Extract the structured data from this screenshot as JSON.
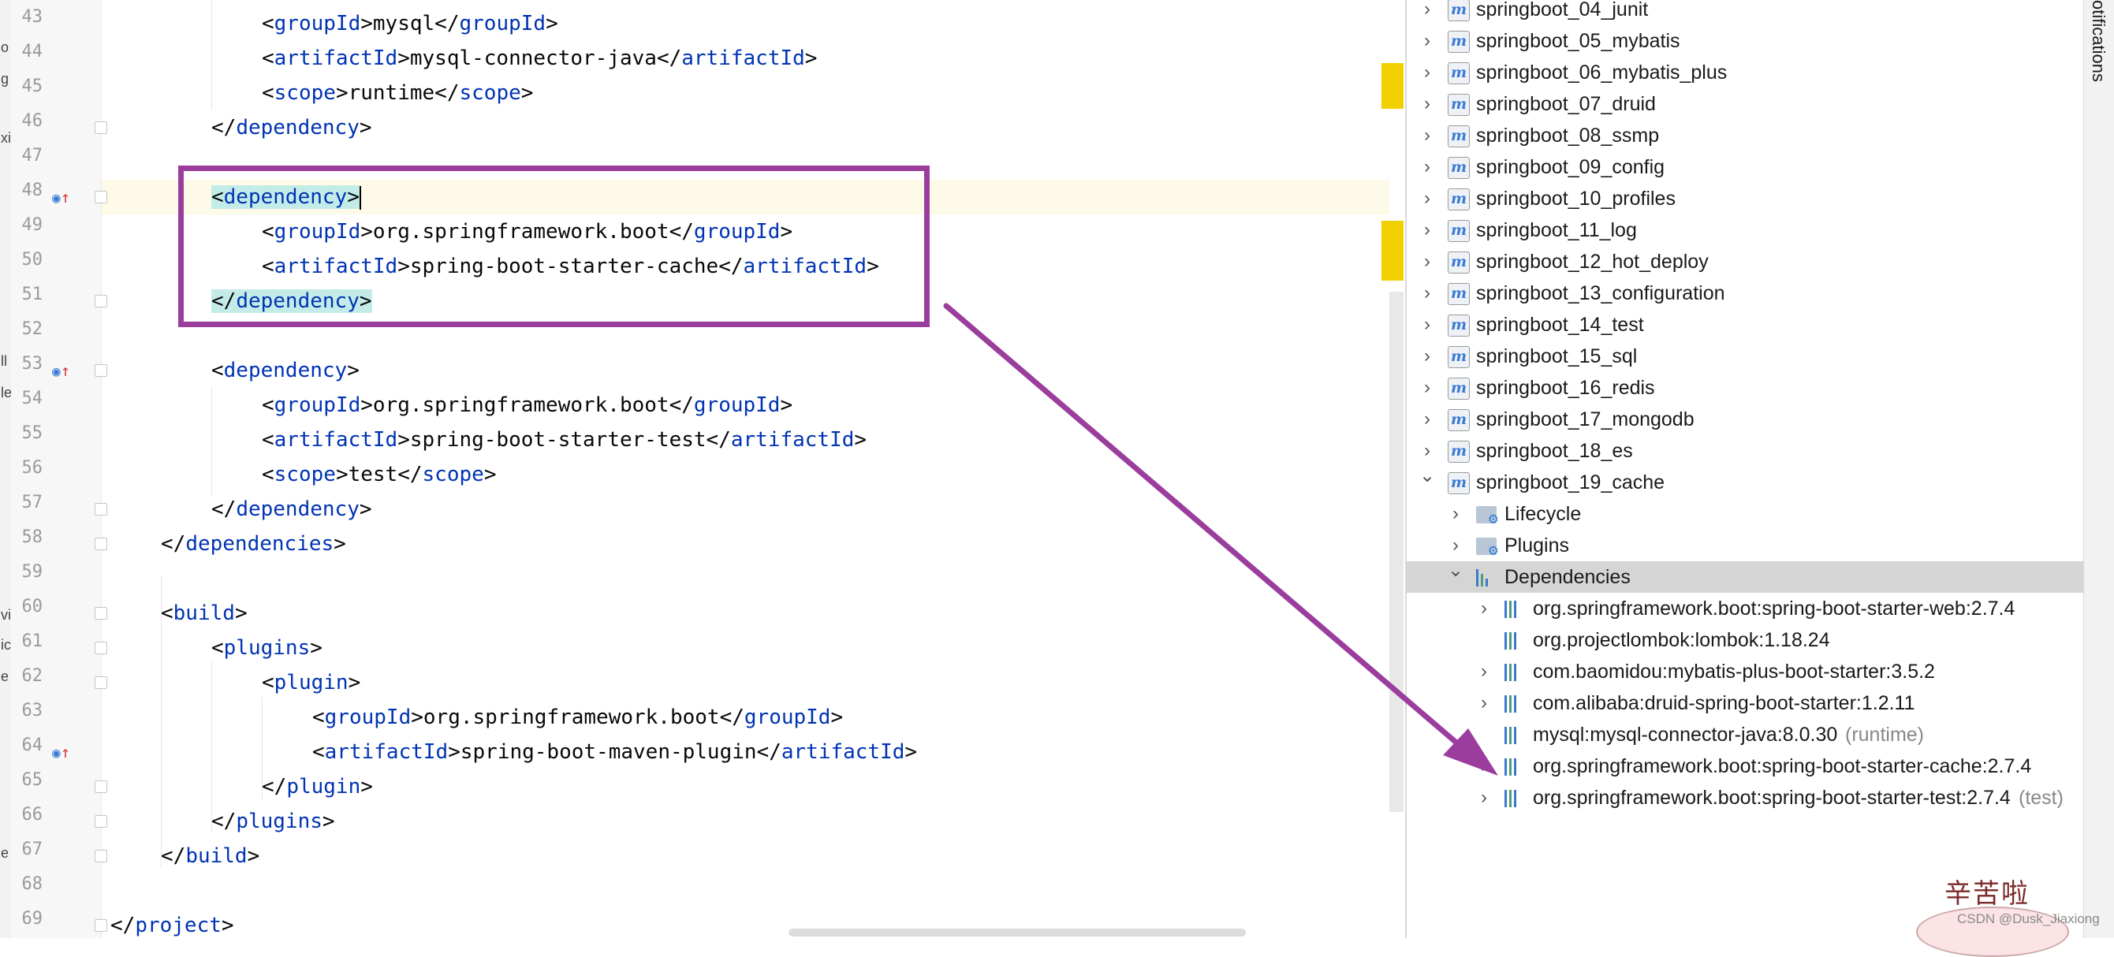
{
  "editor": {
    "gutter_line_numbers": [
      "43",
      "44",
      "45",
      "46",
      "47",
      "48",
      "49",
      "50",
      "51",
      "52",
      "53",
      "54",
      "55",
      "56",
      "57",
      "58",
      "59",
      "60",
      "61",
      "62",
      "63",
      "64",
      "65",
      "66",
      "67",
      "68",
      "69"
    ],
    "code": {
      "l43": {
        "open": "groupId",
        "text": "mysql",
        "close": "groupId"
      },
      "l44": {
        "open": "artifactId",
        "text": "mysql-connector-java",
        "close": "artifactId"
      },
      "l45": {
        "open": "scope",
        "text": "runtime",
        "close": "scope"
      },
      "l46": {
        "close": "dependency"
      },
      "l48": {
        "open": "dependency"
      },
      "l49": {
        "open": "groupId",
        "text": "org.springframework.boot",
        "close": "groupId"
      },
      "l50": {
        "open": "artifactId",
        "text": "spring-boot-starter-cache",
        "close": "artifactId"
      },
      "l51": {
        "close": "dependency"
      },
      "l53": {
        "open": "dependency"
      },
      "l54": {
        "open": "groupId",
        "text": "org.springframework.boot",
        "close": "groupId"
      },
      "l55": {
        "open": "artifactId",
        "text": "spring-boot-starter-test",
        "close": "artifactId"
      },
      "l56": {
        "open": "scope",
        "text": "test",
        "close": "scope"
      },
      "l57": {
        "close": "dependency"
      },
      "l58": {
        "close": "dependencies"
      },
      "l60": {
        "open": "build"
      },
      "l61": {
        "open": "plugins"
      },
      "l62": {
        "open": "plugin"
      },
      "l63": {
        "open": "groupId",
        "text": "org.springframework.boot",
        "close": "groupId"
      },
      "l64": {
        "open": "artifactId",
        "text": "spring-boot-maven-plugin",
        "close": "artifactId"
      },
      "l65": {
        "close": "plugin"
      },
      "l66": {
        "close": "plugins"
      },
      "l67": {
        "close": "build"
      },
      "l69": {
        "close": "project"
      }
    },
    "edge_chars": [
      "o",
      "g",
      "xi",
      "ll",
      "le",
      "vi",
      "ic",
      "e",
      "e"
    ]
  },
  "maven": {
    "modules": [
      "springboot_04_junit",
      "springboot_05_mybatis",
      "springboot_06_mybatis_plus",
      "springboot_07_druid",
      "springboot_08_ssmp",
      "springboot_09_config",
      "springboot_10_profiles",
      "springboot_11_log",
      "springboot_12_hot_deploy",
      "springboot_13_configuration",
      "springboot_14_test",
      "springboot_15_sql",
      "springboot_16_redis",
      "springboot_17_mongodb",
      "springboot_18_es",
      "springboot_19_cache"
    ],
    "children": [
      "Lifecycle",
      "Plugins",
      "Dependencies"
    ],
    "dependencies": [
      {
        "name": "org.springframework.boot:spring-boot-starter-web:2.7.4",
        "scope": ""
      },
      {
        "name": "org.projectlombok:lombok:1.18.24",
        "scope": ""
      },
      {
        "name": "com.baomidou:mybatis-plus-boot-starter:3.5.2",
        "scope": ""
      },
      {
        "name": "com.alibaba:druid-spring-boot-starter:1.2.11",
        "scope": ""
      },
      {
        "name": "mysql:mysql-connector-java:8.0.30",
        "scope": "(runtime)"
      },
      {
        "name": "org.springframework.boot:spring-boot-starter-cache:2.7.4",
        "scope": ""
      },
      {
        "name": "org.springframework.boot:spring-boot-starter-test:2.7.4",
        "scope": "(test)"
      }
    ]
  },
  "side_strip": {
    "label": "otifications"
  },
  "sticker": {
    "text": "辛苦啦",
    "watermark": "CSDN @Dusk_Jiaxiong"
  },
  "colors": {
    "tag": "#0033b3",
    "highlight": "#c3ece9",
    "annotation": "#9a3d9d",
    "selected_row": "#d5d5d5"
  }
}
